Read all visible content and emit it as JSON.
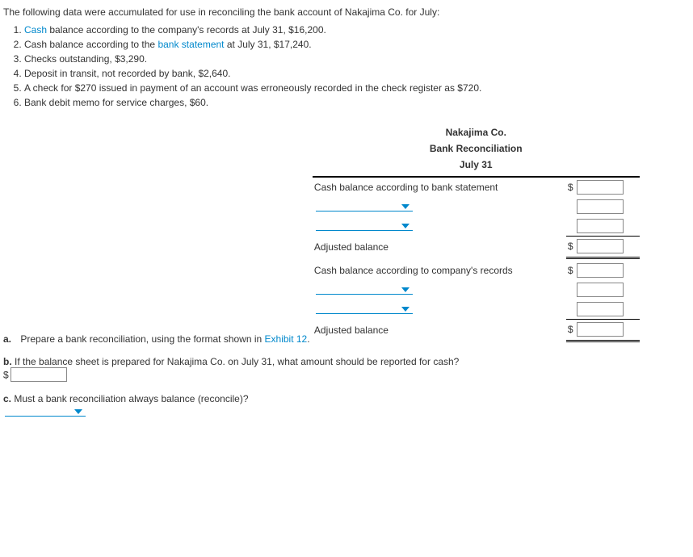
{
  "intro": "The following data were accumulated for use in reconciling the bank account of Nakajima Co. for July:",
  "items": {
    "i1_pre": "",
    "i1_link": "Cash",
    "i1_post": " balance according to the company's records at July 31, $16,200.",
    "i2_pre": "Cash balance according to the ",
    "i2_link": "bank statement",
    "i2_post": " at July 31, $17,240.",
    "i3": "Checks outstanding, $3,290.",
    "i4": "Deposit in transit, not recorded by bank, $2,640.",
    "i5": "A check for $270 issued in payment of an account was erroneously recorded in the check register as $720.",
    "i6": "Bank debit memo for service charges, $60."
  },
  "partA": {
    "letter": "a.",
    "text_pre": "Prepare a bank reconciliation, using the format shown in ",
    "text_link": "Exhibit 12",
    "text_post": "."
  },
  "recon": {
    "company": "Nakajima Co.",
    "title": "Bank Reconciliation",
    "date": "July 31",
    "bank_label": "Cash balance according to bank statement",
    "adj_label": "Adjusted balance",
    "company_label": "Cash balance according to company's records"
  },
  "partB": {
    "letter": "b.",
    "text": "If the balance sheet is prepared for Nakajima Co. on July 31, what amount should be reported for cash?"
  },
  "partC": {
    "letter": "c.",
    "text": "Must a bank reconciliation always balance (reconcile)?"
  }
}
